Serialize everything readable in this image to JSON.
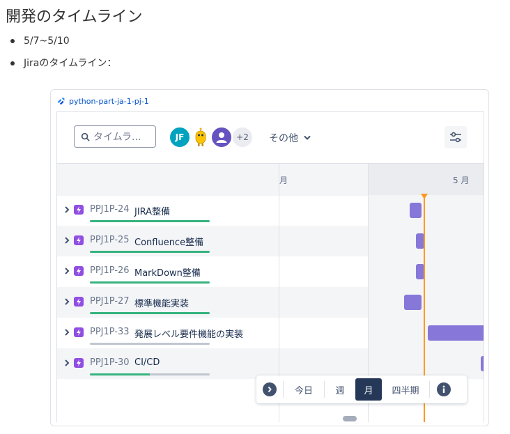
{
  "page": {
    "title": "開発のタイムライン",
    "bullets": [
      "5/7~5/10",
      "Jiraのタイムライン："
    ]
  },
  "card": {
    "project_link": "python-part-ja-1-pj-1"
  },
  "toolbar": {
    "search_placeholder": "タイムラ...",
    "avatars": [
      {
        "type": "initials",
        "label": "JF",
        "color": "#00a3bf"
      },
      {
        "type": "robot-icon"
      },
      {
        "type": "user-icon",
        "color": "#6554c0"
      }
    ],
    "more_avatars": "+2",
    "other_label": "その他"
  },
  "timeline": {
    "months": [
      "月",
      "5 月"
    ],
    "today_color": "#ff991f",
    "bar_color": "#8777d9",
    "rows": [
      {
        "key": "PPJ1P-24",
        "summary": "JIRA整備",
        "progress": 1.0
      },
      {
        "key": "PPJ1P-25",
        "summary": "Confluence整備",
        "progress": 1.0
      },
      {
        "key": "PPJ1P-26",
        "summary": "MarkDown整備",
        "progress": 1.0
      },
      {
        "key": "PPJ1P-27",
        "summary": "標準機能実装",
        "progress": 1.0
      },
      {
        "key": "PPJ1P-33",
        "summary": "発展レベル要件機能の実装",
        "progress": 0.0
      },
      {
        "key": "PPJ1P-30",
        "summary": "CI/CD",
        "progress": 0.5
      }
    ]
  },
  "zoom": {
    "today": "今日",
    "week": "週",
    "month": "月",
    "quarter": "四半期",
    "selected": "月"
  }
}
